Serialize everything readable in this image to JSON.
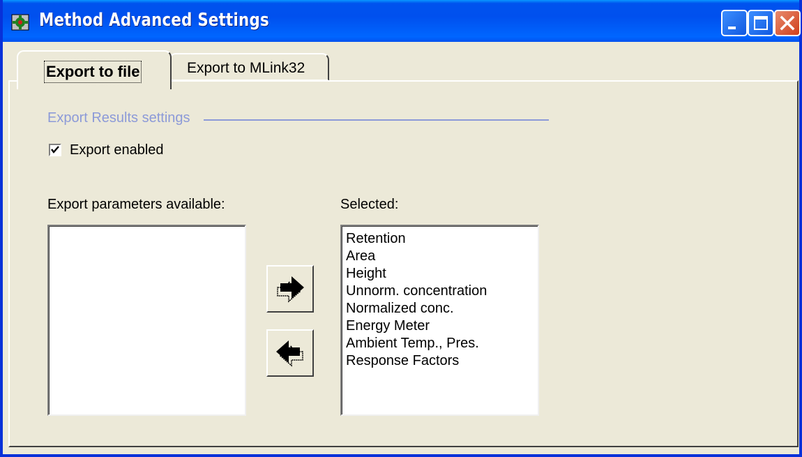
{
  "window": {
    "title": "Method Advanced Settings",
    "title_icon": "app-gear-icon",
    "controls": [
      "minimize-icon",
      "maximize-icon",
      "close-icon"
    ]
  },
  "tabs": [
    {
      "label": "Export to file",
      "active": true
    },
    {
      "label": "Export to MLink32",
      "active": false
    }
  ],
  "export_group": {
    "title": "Export Results settings",
    "export_enabled": {
      "label": "Export enabled",
      "checked": true
    }
  },
  "available": {
    "label": "Export parameters available:",
    "items": []
  },
  "selected": {
    "label": "Selected:",
    "items": [
      "Retention",
      "Area",
      "Height",
      "Unnorm. concentration",
      "Normalized conc.",
      "Energy Meter",
      "Ambient Temp., Pres.",
      "Response Factors"
    ]
  },
  "buttons": {
    "add_icon": "arrow-right-icon",
    "remove_icon": "arrow-left-icon"
  },
  "colors": {
    "titlebar": "#0054e3",
    "window_bg": "#ece9d8",
    "group_label": "#8c9ad8",
    "close_button": "#d0401a"
  }
}
